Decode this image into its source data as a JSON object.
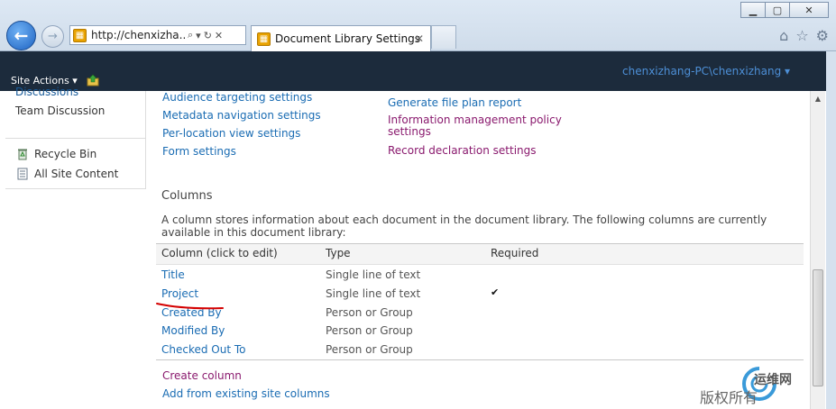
{
  "browser": {
    "address_url": "http://chenxizha...",
    "tab_title": "Document Library Settings"
  },
  "ribbon": {
    "site_actions": "Site Actions",
    "user": "chenxizhang-PC\\chenxizhang"
  },
  "leftnav": {
    "discussions": "Discussions",
    "team_discussion": "Team Discussion",
    "recycle_bin": "Recycle Bin",
    "all_site_content": "All Site Content"
  },
  "settings_links": {
    "left": [
      "Audience targeting settings",
      "Metadata navigation settings",
      "Per-location view settings",
      "Form settings"
    ],
    "right": [
      "Generate file plan report",
      "Information management policy settings",
      "Record declaration settings"
    ]
  },
  "columns": {
    "title": "Columns",
    "description": "A column stores information about each document in the document library. The following columns are currently available in this document library:",
    "headers": [
      "Column (click to edit)",
      "Type",
      "Required"
    ],
    "rows": [
      {
        "name": "Title",
        "type": "Single line of text",
        "required": false
      },
      {
        "name": "Project",
        "type": "Single line of text",
        "required": true
      },
      {
        "name": "Created By",
        "type": "Person or Group",
        "required": false
      },
      {
        "name": "Modified By",
        "type": "Person or Group",
        "required": false
      },
      {
        "name": "Checked Out To",
        "type": "Person or Group",
        "required": false
      }
    ],
    "actions": [
      "Create column",
      "Add from existing site columns"
    ]
  },
  "watermark": {
    "top": "运维网",
    "bottom": "版权所有"
  },
  "colors": {
    "ribbon_bg": "#1c2b3c",
    "link": "#1a6cb3",
    "visited_link": "#8a1a6e",
    "annotation_red": "#d40000"
  }
}
